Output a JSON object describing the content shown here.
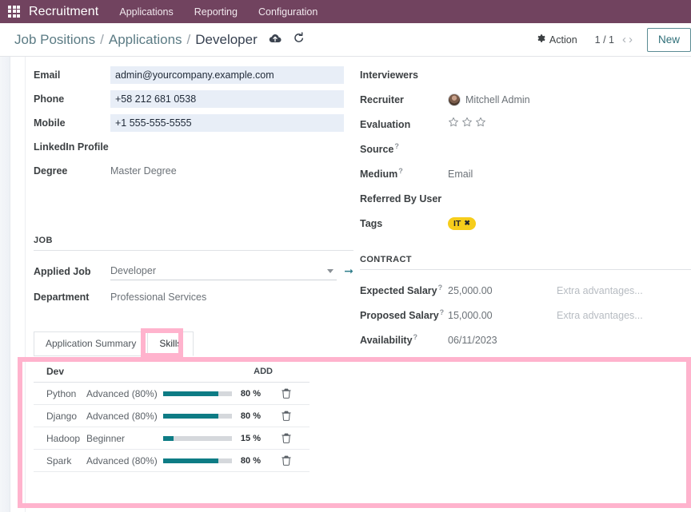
{
  "appbar": {
    "apps_icon": "grid-apps-icon",
    "brand": "Recruitment",
    "menu": [
      {
        "label": "Applications"
      },
      {
        "label": "Reporting"
      },
      {
        "label": "Configuration"
      }
    ],
    "bg_color": "#71435f"
  },
  "breadcrumb": {
    "items": [
      {
        "label": "Job Positions"
      },
      {
        "label": "Applications"
      },
      {
        "label": "Developer"
      }
    ],
    "separator": "/",
    "save_icon": "cloud-upload-icon",
    "discard_icon": "undo-icon"
  },
  "controlbar": {
    "action_label": "Action",
    "action_icon": "gear-icon",
    "pager": "1 / 1",
    "prev_icon": "chevron-left-icon",
    "next_icon": "chevron-right-icon",
    "new_label": "New",
    "new_border_color": "#5b8c94"
  },
  "form": {
    "left": {
      "fields": [
        {
          "label": "Email",
          "value": "admin@yourcompany.example.com",
          "kind": "input"
        },
        {
          "label": "Phone",
          "value": "+58 212 681 0538",
          "kind": "input"
        },
        {
          "label": "Mobile",
          "value": "+1 555-555-5555",
          "kind": "input"
        },
        {
          "label": "LinkedIn Profile",
          "value": "",
          "kind": "text"
        },
        {
          "label": "Degree",
          "value": "Master Degree",
          "kind": "text"
        }
      ],
      "job_section": {
        "title": "JOB",
        "applied_job": {
          "label": "Applied Job",
          "value": "Developer",
          "internal_link_icon": "arrow-right-icon",
          "caret_icon": "chevron-down-icon"
        },
        "department": {
          "label": "Department",
          "value": "Professional Services"
        }
      }
    },
    "right": {
      "interviewers": {
        "label": "Interviewers",
        "value": ""
      },
      "recruiter": {
        "label": "Recruiter",
        "value": "Mitchell Admin",
        "avatar": "user-avatar"
      },
      "evaluation": {
        "label": "Evaluation",
        "stars": 3,
        "filled": 0,
        "star_icon": "star-outline-icon"
      },
      "source": {
        "label": "Source",
        "help": "?",
        "value": ""
      },
      "medium": {
        "label": "Medium",
        "help": "?",
        "value": "Email"
      },
      "referred_by": {
        "label": "Referred By User",
        "value": ""
      },
      "tags": {
        "label": "Tags",
        "items": [
          {
            "label": "IT",
            "color": "#f6cd1b",
            "remove_icon": "close-icon"
          }
        ]
      },
      "contract_section": {
        "title": "CONTRACT",
        "rows": [
          {
            "label": "Expected Salary",
            "help": "?",
            "value": "25,000.00",
            "extra_placeholder": "Extra advantages..."
          },
          {
            "label": "Proposed Salary",
            "help": "?",
            "value": "15,000.00",
            "extra_placeholder": "Extra advantages..."
          },
          {
            "label": "Availability",
            "help": "?",
            "value": "06/11/2023",
            "extra_placeholder": ""
          }
        ]
      }
    }
  },
  "notebook": {
    "tabs": [
      {
        "label": "Application Summary",
        "active": false
      },
      {
        "label": "Skills",
        "active": true
      }
    ]
  },
  "skills": {
    "group_label": "Dev",
    "add_label": "ADD",
    "bar_color": "#0e7c85",
    "bar_track_color": "#d5d8dc",
    "delete_icon": "trash-icon",
    "rows": [
      {
        "name": "Python",
        "level": "Advanced (80%)",
        "percent": 80,
        "percent_label": "80 %"
      },
      {
        "name": "Django",
        "level": "Advanced (80%)",
        "percent": 80,
        "percent_label": "80 %"
      },
      {
        "name": "Hadoop",
        "level": "Beginner",
        "percent": 15,
        "percent_label": "15 %"
      },
      {
        "name": "Spark",
        "level": "Advanced (80%)",
        "percent": 80,
        "percent_label": "80 %"
      }
    ]
  },
  "annotations": {
    "highlight_color": "#ffb3cd",
    "regions": [
      {
        "name": "skills-tab-highlight"
      },
      {
        "name": "skills-panel-highlight"
      }
    ]
  }
}
